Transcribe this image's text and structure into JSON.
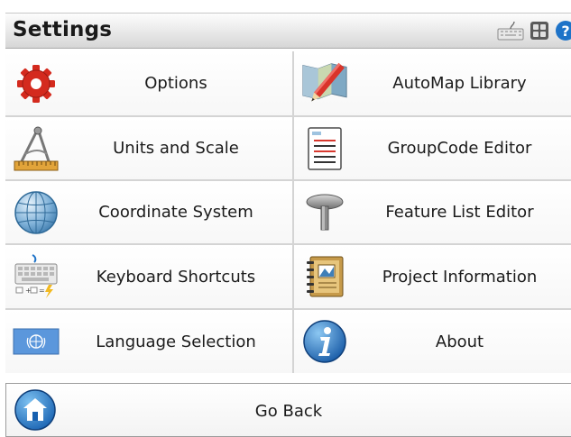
{
  "window": {
    "title": "Settings"
  },
  "toolbar": {
    "icons": [
      "keyboard-icon",
      "grid-tiles-icon",
      "help-icon"
    ]
  },
  "menu": {
    "items": [
      {
        "label": "Options",
        "icon": "red-gear-icon"
      },
      {
        "label": "AutoMap Library",
        "icon": "map-pencil-icon"
      },
      {
        "label": "Units and Scale",
        "icon": "compass-ruler-icon"
      },
      {
        "label": "GroupCode Editor",
        "icon": "document-list-icon"
      },
      {
        "label": "Coordinate System",
        "icon": "globe-icon"
      },
      {
        "label": "Feature List Editor",
        "icon": "pin-icon"
      },
      {
        "label": "Keyboard Shortcuts",
        "icon": "keyboard-shortcut-icon"
      },
      {
        "label": "Project Information",
        "icon": "notebook-icon"
      },
      {
        "label": "Language Selection",
        "icon": "un-flag-icon"
      },
      {
        "label": "About",
        "icon": "info-icon"
      }
    ]
  },
  "footer": {
    "go_back_label": "Go Back",
    "icon": "home-icon"
  },
  "colors": {
    "accent_blue": "#1e73c8",
    "gear_red": "#d42a1e",
    "title_bar": "#dcdcdc"
  }
}
